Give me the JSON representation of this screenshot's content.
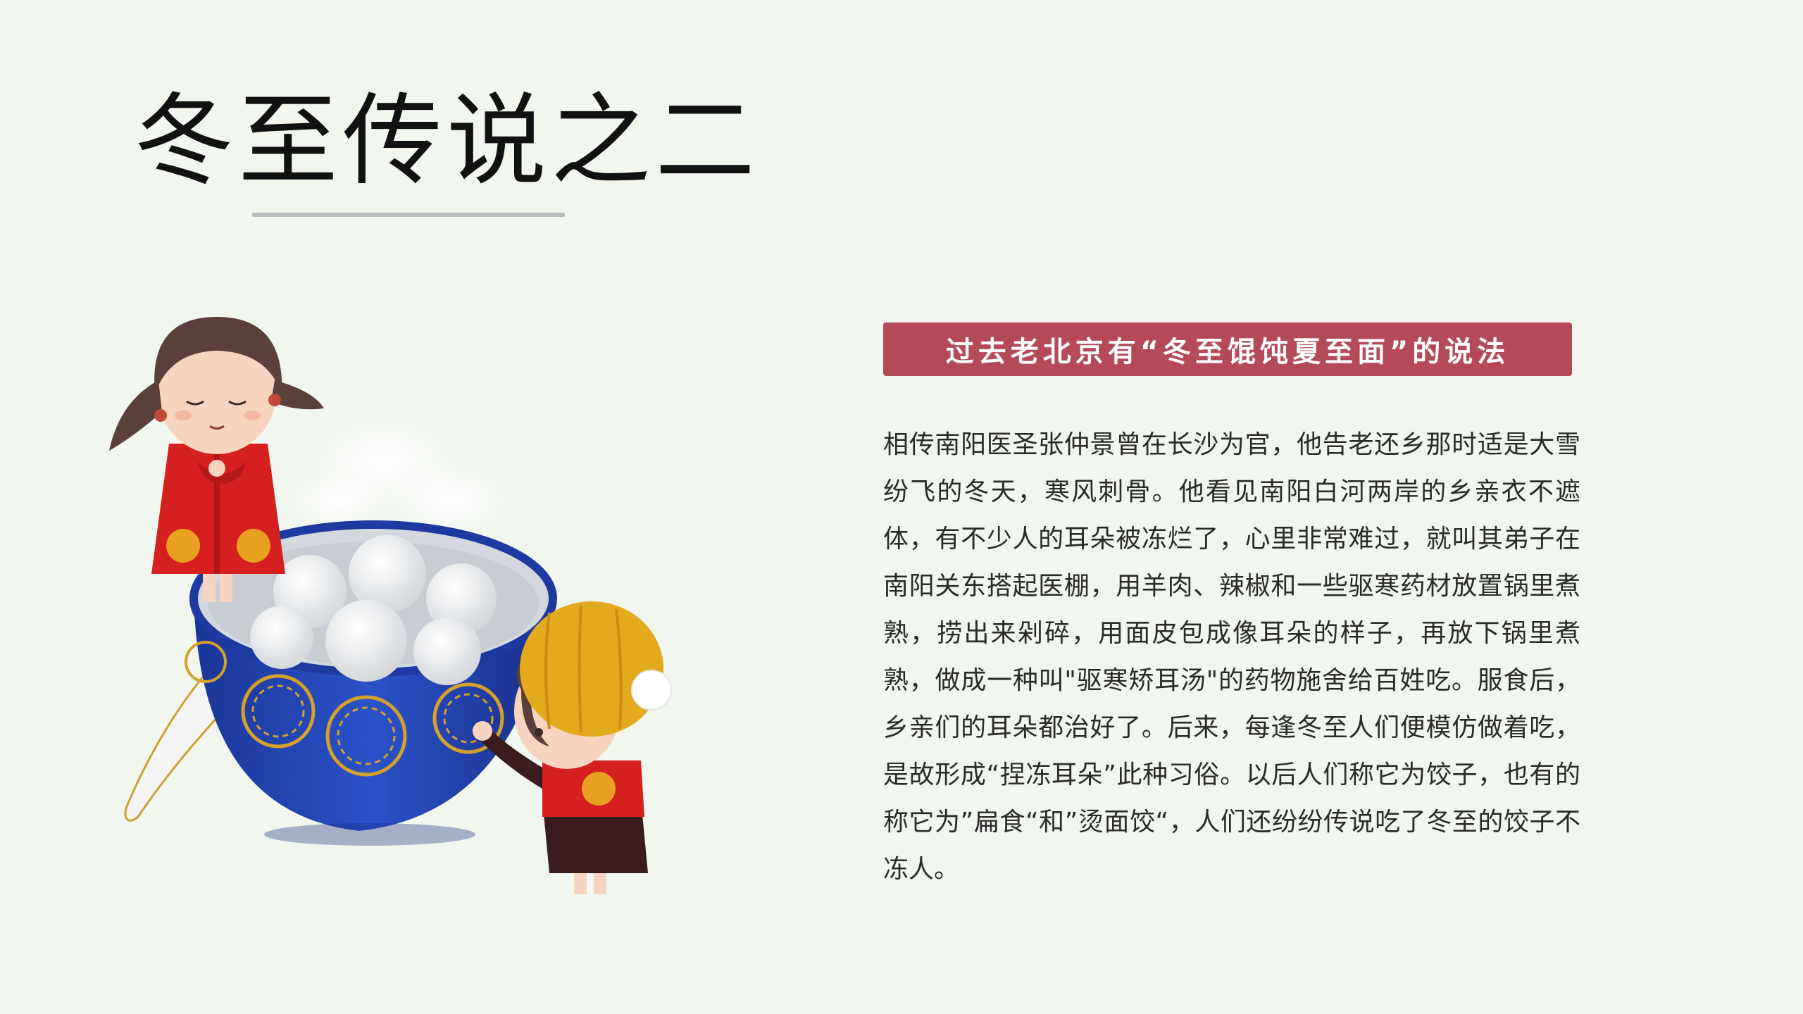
{
  "slide": {
    "title": "冬至传说之二",
    "banner": "过去老北京有“冬至馄饨夏至面”的说法",
    "paragraph": "相传南阳医圣张仲景曾在长沙为官，他告老还乡那时适是大雪纷飞的冬天，寒风刺骨。他看见南阳白河两岸的乡亲衣不遮体，有不少人的耳朵被冻烂了，心里非常难过，就叫其弟子在南阳关东搭起医棚，用羊肉、辣椒和一些驱寒药材放置锅里煮熟，捞出来剁碎，用面皮包成像耳朵的样子，再放下锅里煮熟，做成一种叫\"驱寒矫耳汤\"的药物施舍给百姓吃。服食后，乡亲们的耳朵都治好了。后来，每逢冬至人们便模仿做着吃，是故形成“捏冻耳朵”此种习俗。以后人们称它为饺子，也有的称它为”扁食“和”烫面饺“，人们还纷纷传说吃了冬至的饺子不冻人。"
  },
  "colors": {
    "background": "#f1f6ef",
    "banner": "#b34a55",
    "bowl": "#1f3fa8",
    "outfit_red": "#d5201f",
    "hat_gold": "#e3aa1d"
  },
  "illustration": {
    "icons": [
      "dumpling-bowl-icon",
      "spoon-icon",
      "girl-character-icon",
      "boy-character-icon",
      "steam-cloud-icon"
    ]
  }
}
